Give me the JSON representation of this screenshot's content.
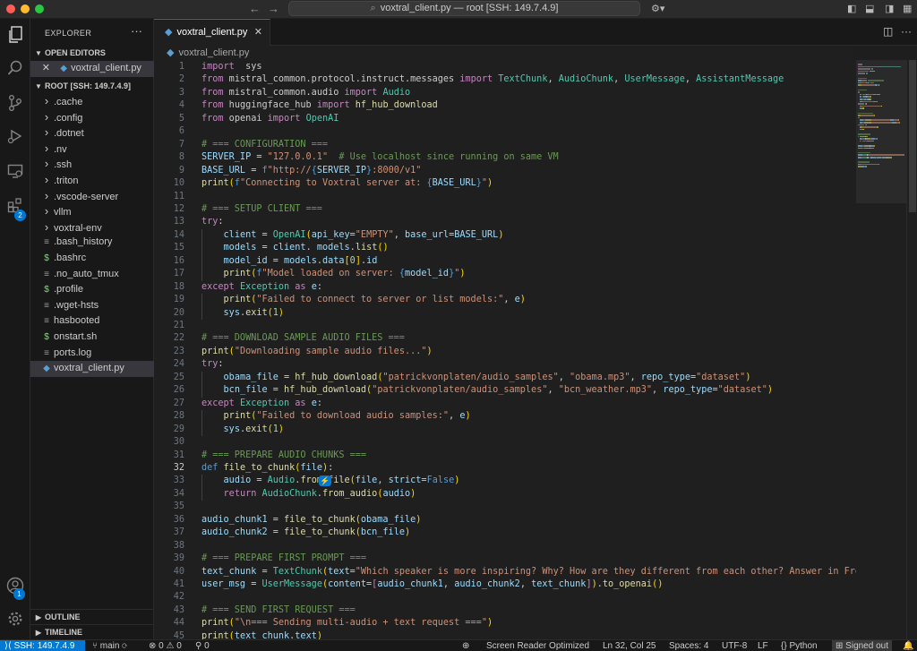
{
  "window": {
    "title": "voxtral_client.py — root [SSH: 149.7.4.9]"
  },
  "sidebar": {
    "title": "EXPLORER",
    "open_editors_label": "OPEN EDITORS",
    "open_editor_file": "voxtral_client.py",
    "root_label": "ROOT [SSH: 149.7.4.9]",
    "items": [
      {
        "name": ".cache",
        "kind": "folder"
      },
      {
        "name": ".config",
        "kind": "folder"
      },
      {
        "name": ".dotnet",
        "kind": "folder"
      },
      {
        "name": ".nv",
        "kind": "folder"
      },
      {
        "name": ".ssh",
        "kind": "folder"
      },
      {
        "name": ".triton",
        "kind": "folder"
      },
      {
        "name": ".vscode-server",
        "kind": "folder"
      },
      {
        "name": "vllm",
        "kind": "folder"
      },
      {
        "name": "voxtral-env",
        "kind": "folder"
      },
      {
        "name": ".bash_history",
        "kind": "text"
      },
      {
        "name": ".bashrc",
        "kind": "shell"
      },
      {
        "name": ".no_auto_tmux",
        "kind": "text"
      },
      {
        "name": ".profile",
        "kind": "shell"
      },
      {
        "name": ".wget-hsts",
        "kind": "text"
      },
      {
        "name": "hasbooted",
        "kind": "text"
      },
      {
        "name": "onstart.sh",
        "kind": "shell"
      },
      {
        "name": "ports.log",
        "kind": "text"
      },
      {
        "name": "voxtral_client.py",
        "kind": "python"
      }
    ],
    "outline_label": "OUTLINE",
    "timeline_label": "TIMELINE"
  },
  "activity": {
    "source_control_badge": "2",
    "accounts_badge": "1"
  },
  "editor": {
    "tab_label": "voxtral_client.py",
    "breadcrumb": "voxtral_client.py",
    "first_line": 1,
    "current_line": 32,
    "lines": [
      [
        [
          "kw",
          "import"
        ],
        [
          "",
          "  sys"
        ]
      ],
      [
        [
          "kw",
          "from"
        ],
        [
          "",
          " mistral_common.protocol.instruct.messages "
        ],
        [
          "kw",
          "import"
        ],
        [
          "",
          " "
        ],
        [
          "cls",
          "TextChunk"
        ],
        [
          "",
          ", "
        ],
        [
          "cls",
          "AudioChunk"
        ],
        [
          "",
          ", "
        ],
        [
          "cls",
          "UserMessage"
        ],
        [
          "",
          ", "
        ],
        [
          "cls",
          "AssistantMessage"
        ]
      ],
      [
        [
          "kw",
          "from"
        ],
        [
          "",
          " mistral_common.audio "
        ],
        [
          "kw",
          "import"
        ],
        [
          "",
          " "
        ],
        [
          "cls",
          "Audio"
        ]
      ],
      [
        [
          "kw",
          "from"
        ],
        [
          "",
          " huggingface_hub "
        ],
        [
          "kw",
          "import"
        ],
        [
          "",
          " "
        ],
        [
          "fn",
          "hf_hub_download"
        ]
      ],
      [
        [
          "kw",
          "from"
        ],
        [
          "",
          " openai "
        ],
        [
          "kw",
          "import"
        ],
        [
          "",
          " "
        ],
        [
          "cls",
          "OpenAI"
        ]
      ],
      [],
      [
        [
          "cm",
          "# === CONFIGURATION ==="
        ]
      ],
      [
        [
          "var",
          "SERVER_IP"
        ],
        [
          "",
          " = "
        ],
        [
          "str",
          "\"127.0.0.1\""
        ],
        [
          "",
          "  "
        ],
        [
          "cm",
          "# Use localhost since running on same VM"
        ]
      ],
      [
        [
          "var",
          "BASE_URL"
        ],
        [
          "",
          " = "
        ],
        [
          "kw2",
          "f"
        ],
        [
          "str",
          "\"http://"
        ],
        [
          "kw2",
          "{"
        ],
        [
          "var",
          "SERVER_IP"
        ],
        [
          "kw2",
          "}"
        ],
        [
          "str",
          ":8000/v1\""
        ]
      ],
      [
        [
          "fn",
          "print"
        ],
        [
          "br",
          "("
        ],
        [
          "kw2",
          "f"
        ],
        [
          "str",
          "\"Connecting to Voxtral server at: "
        ],
        [
          "kw2",
          "{"
        ],
        [
          "var",
          "BASE_URL"
        ],
        [
          "kw2",
          "}"
        ],
        [
          "str",
          "\""
        ],
        [
          "br",
          ")"
        ]
      ],
      [],
      [
        [
          "cm",
          "# === SETUP CLIENT ==="
        ]
      ],
      [
        [
          "kw",
          "try"
        ],
        [
          "",
          ":"
        ]
      ],
      [
        [
          "",
          "    "
        ],
        [
          "var",
          "client"
        ],
        [
          "",
          " = "
        ],
        [
          "cls",
          "OpenAI"
        ],
        [
          "br",
          "("
        ],
        [
          "var",
          "api_key"
        ],
        [
          "",
          "="
        ],
        [
          "str",
          "\"EMPTY\""
        ],
        [
          "",
          ", "
        ],
        [
          "var",
          "base_url"
        ],
        [
          "",
          "="
        ],
        [
          "var",
          "BASE_URL"
        ],
        [
          "br",
          ")"
        ]
      ],
      [
        [
          "",
          "    "
        ],
        [
          "var",
          "models"
        ],
        [
          "",
          " = "
        ],
        [
          "var",
          "client"
        ],
        [
          "",
          ". "
        ],
        [
          "var",
          "models"
        ],
        [
          "",
          "."
        ],
        [
          "fn",
          "list"
        ],
        [
          "br",
          "()"
        ]
      ],
      [
        [
          "",
          "    "
        ],
        [
          "var",
          "model_id"
        ],
        [
          "",
          " = "
        ],
        [
          "var",
          "models"
        ],
        [
          "",
          "."
        ],
        [
          "var",
          "data"
        ],
        [
          "br",
          "["
        ],
        [
          "num",
          "0"
        ],
        [
          "br",
          "]"
        ],
        [
          "",
          "."
        ],
        [
          "var",
          "id"
        ]
      ],
      [
        [
          "",
          "    "
        ],
        [
          "fn",
          "print"
        ],
        [
          "br",
          "("
        ],
        [
          "kw2",
          "f"
        ],
        [
          "str",
          "\"Model loaded on server: "
        ],
        [
          "kw2",
          "{"
        ],
        [
          "var",
          "model_id"
        ],
        [
          "kw2",
          "}"
        ],
        [
          "str",
          "\""
        ],
        [
          "br",
          ")"
        ]
      ],
      [
        [
          "kw",
          "except"
        ],
        [
          "",
          " "
        ],
        [
          "cls",
          "Exception"
        ],
        [
          "",
          " "
        ],
        [
          "kw",
          "as"
        ],
        [
          "",
          " "
        ],
        [
          "var",
          "e"
        ],
        [
          "",
          ":"
        ]
      ],
      [
        [
          "",
          "    "
        ],
        [
          "fn",
          "print"
        ],
        [
          "br",
          "("
        ],
        [
          "str",
          "\"Failed to connect to server or list models:\""
        ],
        [
          "",
          ", "
        ],
        [
          "var",
          "e"
        ],
        [
          "br",
          ")"
        ]
      ],
      [
        [
          "",
          "    "
        ],
        [
          "var",
          "sys"
        ],
        [
          "",
          "."
        ],
        [
          "fn",
          "exit"
        ],
        [
          "br",
          "("
        ],
        [
          "num",
          "1"
        ],
        [
          "br",
          ")"
        ]
      ],
      [],
      [
        [
          "cm",
          "# === DOWNLOAD SAMPLE AUDIO FILES ==="
        ]
      ],
      [
        [
          "fn",
          "print"
        ],
        [
          "br",
          "("
        ],
        [
          "str",
          "\"Downloading sample audio files...\""
        ],
        [
          "br",
          ")"
        ]
      ],
      [
        [
          "kw",
          "try"
        ],
        [
          "",
          ":"
        ]
      ],
      [
        [
          "",
          "    "
        ],
        [
          "var",
          "obama_file"
        ],
        [
          "",
          " = "
        ],
        [
          "fn",
          "hf_hub_download"
        ],
        [
          "br",
          "("
        ],
        [
          "str",
          "\"patrickvonplaten/audio_samples\""
        ],
        [
          "",
          ", "
        ],
        [
          "str",
          "\"obama.mp3\""
        ],
        [
          "",
          ", "
        ],
        [
          "var",
          "repo_type"
        ],
        [
          "",
          "="
        ],
        [
          "str",
          "\"dataset\""
        ],
        [
          "br",
          ")"
        ]
      ],
      [
        [
          "",
          "    "
        ],
        [
          "var",
          "bcn_file"
        ],
        [
          "",
          " = "
        ],
        [
          "fn",
          "hf_hub_download"
        ],
        [
          "br",
          "("
        ],
        [
          "str",
          "\"patrickvonplaten/audio_samples\""
        ],
        [
          "",
          ", "
        ],
        [
          "str",
          "\"bcn_weather.mp3\""
        ],
        [
          "",
          ", "
        ],
        [
          "var",
          "repo_type"
        ],
        [
          "",
          "="
        ],
        [
          "str",
          "\"dataset\""
        ],
        [
          "br",
          ")"
        ]
      ],
      [
        [
          "kw",
          "except"
        ],
        [
          "",
          " "
        ],
        [
          "cls",
          "Exception"
        ],
        [
          "",
          " "
        ],
        [
          "kw",
          "as"
        ],
        [
          "",
          " "
        ],
        [
          "var",
          "e"
        ],
        [
          "",
          ":"
        ]
      ],
      [
        [
          "",
          "    "
        ],
        [
          "fn",
          "print"
        ],
        [
          "br",
          "("
        ],
        [
          "str",
          "\"Failed to download audio samples:\""
        ],
        [
          "",
          ", "
        ],
        [
          "var",
          "e"
        ],
        [
          "br",
          ")"
        ]
      ],
      [
        [
          "",
          "    "
        ],
        [
          "var",
          "sys"
        ],
        [
          "",
          "."
        ],
        [
          "fn",
          "exit"
        ],
        [
          "br",
          "("
        ],
        [
          "num",
          "1"
        ],
        [
          "br",
          ")"
        ]
      ],
      [],
      [
        [
          "cm",
          "# === PREPARE AUDIO CHUNKS ==="
        ]
      ],
      [
        [
          "kw2",
          "def"
        ],
        [
          "",
          " "
        ],
        [
          "fn",
          "file_to_chunk"
        ],
        [
          "br",
          "("
        ],
        [
          "var",
          "file"
        ],
        [
          "br",
          ")"
        ],
        [
          "",
          ":"
        ]
      ],
      [
        [
          "",
          "    "
        ],
        [
          "var",
          "audio"
        ],
        [
          "",
          " = "
        ],
        [
          "cls",
          "Audio"
        ],
        [
          "",
          "."
        ],
        [
          "fn",
          "from_file"
        ],
        [
          "br",
          "("
        ],
        [
          "var",
          "file"
        ],
        [
          "",
          ", "
        ],
        [
          "var",
          "strict"
        ],
        [
          "",
          "="
        ],
        [
          "kw2",
          "False"
        ],
        [
          "br",
          ")"
        ]
      ],
      [
        [
          "",
          "    "
        ],
        [
          "kw",
          "return"
        ],
        [
          "",
          " "
        ],
        [
          "cls",
          "AudioChunk"
        ],
        [
          "",
          "."
        ],
        [
          "fn",
          "from_audio"
        ],
        [
          "br",
          "("
        ],
        [
          "var",
          "audio"
        ],
        [
          "br",
          ")"
        ]
      ],
      [],
      [
        [
          "var",
          "audio_chunk1"
        ],
        [
          "",
          " = "
        ],
        [
          "fn",
          "file_to_chunk"
        ],
        [
          "br",
          "("
        ],
        [
          "var",
          "obama_file"
        ],
        [
          "br",
          ")"
        ]
      ],
      [
        [
          "var",
          "audio_chunk2"
        ],
        [
          "",
          " = "
        ],
        [
          "fn",
          "file_to_chunk"
        ],
        [
          "br",
          "("
        ],
        [
          "var",
          "bcn_file"
        ],
        [
          "br",
          ")"
        ]
      ],
      [],
      [
        [
          "cm",
          "# === PREPARE FIRST PROMPT ==="
        ]
      ],
      [
        [
          "var",
          "text_chunk"
        ],
        [
          "",
          " = "
        ],
        [
          "cls",
          "TextChunk"
        ],
        [
          "br",
          "("
        ],
        [
          "var",
          "text"
        ],
        [
          "",
          "="
        ],
        [
          "str",
          "\"Which speaker is more inspiring? Why? How are they different from each other? Answer in French.\""
        ],
        [
          "br",
          ")"
        ]
      ],
      [
        [
          "var",
          "user_msg"
        ],
        [
          "",
          " = "
        ],
        [
          "cls",
          "UserMessage"
        ],
        [
          "br",
          "("
        ],
        [
          "var",
          "content"
        ],
        [
          "",
          "="
        ],
        [
          "br2",
          "["
        ],
        [
          "var",
          "audio_chunk1"
        ],
        [
          "",
          ", "
        ],
        [
          "var",
          "audio_chunk2"
        ],
        [
          "",
          ", "
        ],
        [
          "var",
          "text_chunk"
        ],
        [
          "br2",
          "]"
        ],
        [
          "br",
          ")"
        ],
        [
          "",
          "."
        ],
        [
          "fn",
          "to_openai"
        ],
        [
          "br",
          "()"
        ]
      ],
      [],
      [
        [
          "cm",
          "# === SEND FIRST REQUEST ==="
        ]
      ],
      [
        [
          "fn",
          "print"
        ],
        [
          "br",
          "("
        ],
        [
          "str",
          "\"\\n=== Sending multi-audio + text request ===\""
        ],
        [
          "br",
          ")"
        ]
      ],
      [
        [
          "fn",
          "print"
        ],
        [
          "br",
          "("
        ],
        [
          "var",
          "text_chunk"
        ],
        [
          "",
          "."
        ],
        [
          "var",
          "text"
        ],
        [
          "br",
          ")"
        ]
      ]
    ]
  },
  "statusbar": {
    "remote": "SSH: 149.7.4.9",
    "branch": "main",
    "errors": "0",
    "warnings": "0",
    "ports": "0",
    "screen_reader": "Screen Reader Optimized",
    "position": "Ln 32, Col 25",
    "spaces": "Spaces: 4",
    "encoding": "UTF-8",
    "eol": "LF",
    "language": "Python",
    "account": "Signed out"
  }
}
